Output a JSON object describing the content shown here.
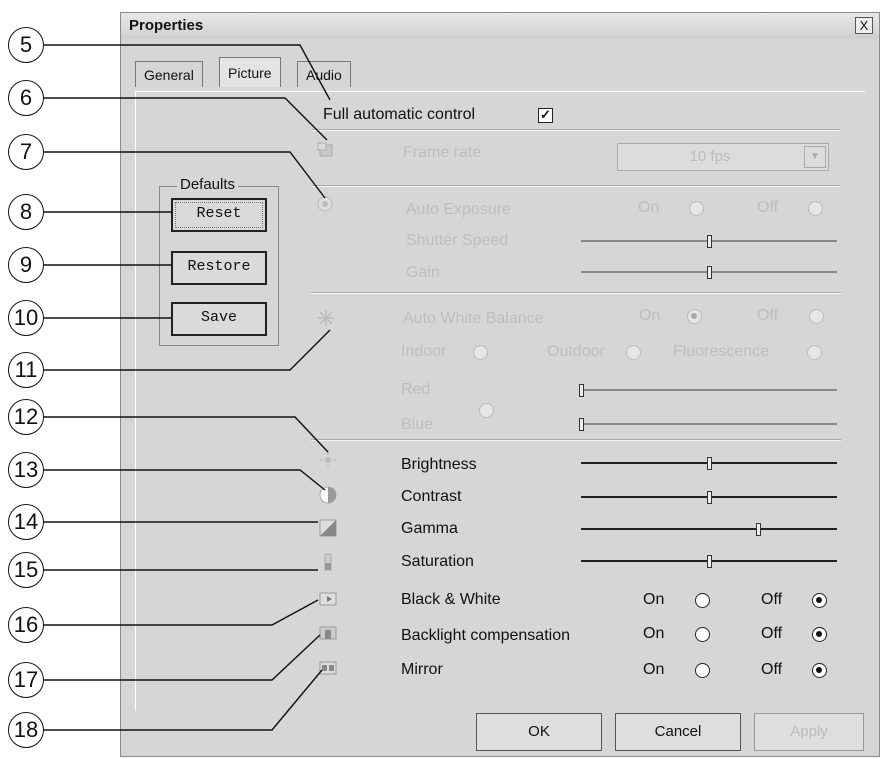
{
  "window": {
    "title": "Properties",
    "close_label": "X"
  },
  "tabs": [
    {
      "label": "General"
    },
    {
      "label": "Picture"
    },
    {
      "label": "Audio"
    }
  ],
  "full_auto": {
    "label": "Full automatic control",
    "checked": true,
    "check_glyph": "✓"
  },
  "frame_rate": {
    "label": "Frame rate",
    "value": "10 fps"
  },
  "exposure": {
    "label": "Auto Exposure",
    "on_label": "On",
    "off_label": "Off",
    "shutter_label": "Shutter Speed",
    "shutter_value": 0.5,
    "gain_label": "Gain",
    "gain_value": 0.5
  },
  "white_balance": {
    "label": "Auto White Balance",
    "on_label": "On",
    "off_label": "Off",
    "selected": "On",
    "indoor_label": "Indoor",
    "outdoor_label": "Outdoor",
    "fluorescence_label": "Fluorescence",
    "red_label": "Red",
    "red_value": 0.0,
    "blue_label": "Blue",
    "blue_value": 0.0
  },
  "defaults": {
    "title": "Defaults",
    "reset_label": "Reset",
    "restore_label": "Restore",
    "save_label": "Save"
  },
  "adjustments": [
    {
      "label": "Brightness",
      "value": 0.5
    },
    {
      "label": "Contrast",
      "value": 0.5
    },
    {
      "label": "Gamma",
      "value": 0.69
    },
    {
      "label": "Saturation",
      "value": 0.5
    }
  ],
  "toggles": [
    {
      "label": "Black & White",
      "on_label": "On",
      "off_label": "Off",
      "selected": "Off"
    },
    {
      "label": "Backlight compensation",
      "on_label": "On",
      "off_label": "Off",
      "selected": "Off"
    },
    {
      "label": "Mirror",
      "on_label": "On",
      "off_label": "Off",
      "selected": "Off"
    }
  ],
  "dialog_buttons": {
    "ok_label": "OK",
    "cancel_label": "Cancel",
    "apply_label": "Apply"
  },
  "callouts": [
    "5",
    "6",
    "7",
    "8",
    "9",
    "10",
    "11",
    "12",
    "13",
    "14",
    "15",
    "16",
    "17",
    "18"
  ]
}
